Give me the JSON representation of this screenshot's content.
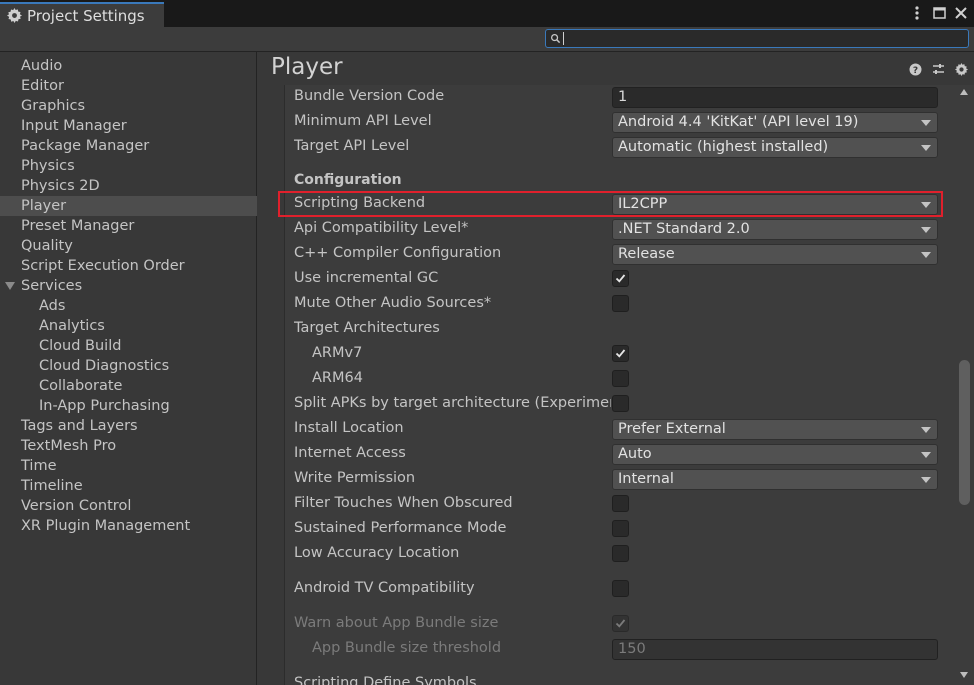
{
  "window": {
    "tab_title": "Project Settings",
    "icons": [
      "gear-icon",
      "kebab-menu-icon",
      "maximize-icon",
      "close-icon"
    ]
  },
  "search": {
    "placeholder": "",
    "value": ""
  },
  "sidebar": {
    "items": [
      {
        "label": "Audio",
        "level": 0
      },
      {
        "label": "Editor",
        "level": 0
      },
      {
        "label": "Graphics",
        "level": 0
      },
      {
        "label": "Input Manager",
        "level": 0
      },
      {
        "label": "Package Manager",
        "level": 0
      },
      {
        "label": "Physics",
        "level": 0
      },
      {
        "label": "Physics 2D",
        "level": 0
      },
      {
        "label": "Player",
        "level": 0,
        "selected": true
      },
      {
        "label": "Preset Manager",
        "level": 0
      },
      {
        "label": "Quality",
        "level": 0
      },
      {
        "label": "Script Execution Order",
        "level": 0
      },
      {
        "label": "Services",
        "level": 0,
        "expanded": true
      },
      {
        "label": "Ads",
        "level": 1
      },
      {
        "label": "Analytics",
        "level": 1
      },
      {
        "label": "Cloud Build",
        "level": 1
      },
      {
        "label": "Cloud Diagnostics",
        "level": 1
      },
      {
        "label": "Collaborate",
        "level": 1
      },
      {
        "label": "In-App Purchasing",
        "level": 1
      },
      {
        "label": "Tags and Layers",
        "level": 0
      },
      {
        "label": "TextMesh Pro",
        "level": 0
      },
      {
        "label": "Time",
        "level": 0
      },
      {
        "label": "Timeline",
        "level": 0
      },
      {
        "label": "Version Control",
        "level": 0
      },
      {
        "label": "XR Plugin Management",
        "level": 0
      }
    ]
  },
  "main": {
    "title": "Player",
    "header_icons": [
      "help-icon",
      "presets-icon",
      "settings-gear-icon"
    ],
    "rows": [
      {
        "label": "Bundle Version Code",
        "kind": "text",
        "value": "1"
      },
      {
        "label": "Minimum API Level",
        "kind": "dropdown",
        "value": "Android 4.4 'KitKat' (API level 19)"
      },
      {
        "label": "Target API Level",
        "kind": "dropdown",
        "value": "Automatic (highest installed)"
      },
      {
        "label": "Configuration",
        "kind": "header"
      },
      {
        "label": "Scripting Backend",
        "kind": "dropdown",
        "value": "IL2CPP",
        "highlighted": true
      },
      {
        "label": "Api Compatibility Level*",
        "kind": "dropdown",
        "value": ".NET Standard 2.0"
      },
      {
        "label": "C++ Compiler Configuration",
        "kind": "dropdown",
        "value": "Release"
      },
      {
        "label": "Use incremental GC",
        "kind": "checkbox",
        "checked": true
      },
      {
        "label": "Mute Other Audio Sources*",
        "kind": "checkbox",
        "checked": false
      },
      {
        "label": "Target Architectures",
        "kind": "label"
      },
      {
        "label": "ARMv7",
        "kind": "checkbox",
        "checked": true,
        "indent": true
      },
      {
        "label": "ARM64",
        "kind": "checkbox",
        "checked": false,
        "indent": true
      },
      {
        "label": "Split APKs by target architecture (Experimen",
        "kind": "checkbox",
        "checked": false
      },
      {
        "label": "Install Location",
        "kind": "dropdown",
        "value": "Prefer External"
      },
      {
        "label": "Internet Access",
        "kind": "dropdown",
        "value": "Auto"
      },
      {
        "label": "Write Permission",
        "kind": "dropdown",
        "value": "Internal"
      },
      {
        "label": "Filter Touches When Obscured",
        "kind": "checkbox",
        "checked": false
      },
      {
        "label": "Sustained Performance Mode",
        "kind": "checkbox",
        "checked": false
      },
      {
        "label": "Low Accuracy Location",
        "kind": "checkbox",
        "checked": false
      },
      {
        "label": "Android TV Compatibility",
        "kind": "checkbox",
        "checked": false
      },
      {
        "label": "Warn about App Bundle size",
        "kind": "checkbox",
        "checked": true,
        "disabled": true
      },
      {
        "label": "App Bundle size threshold",
        "kind": "text",
        "value": "150",
        "indent": true,
        "disabled": true
      },
      {
        "label": "Scripting Define Symbols",
        "kind": "label"
      }
    ]
  },
  "colors": {
    "accent": "#3a79bb",
    "highlight_box": "#e0202c",
    "selected_item": "#4d4d4d",
    "background": "#383838"
  }
}
